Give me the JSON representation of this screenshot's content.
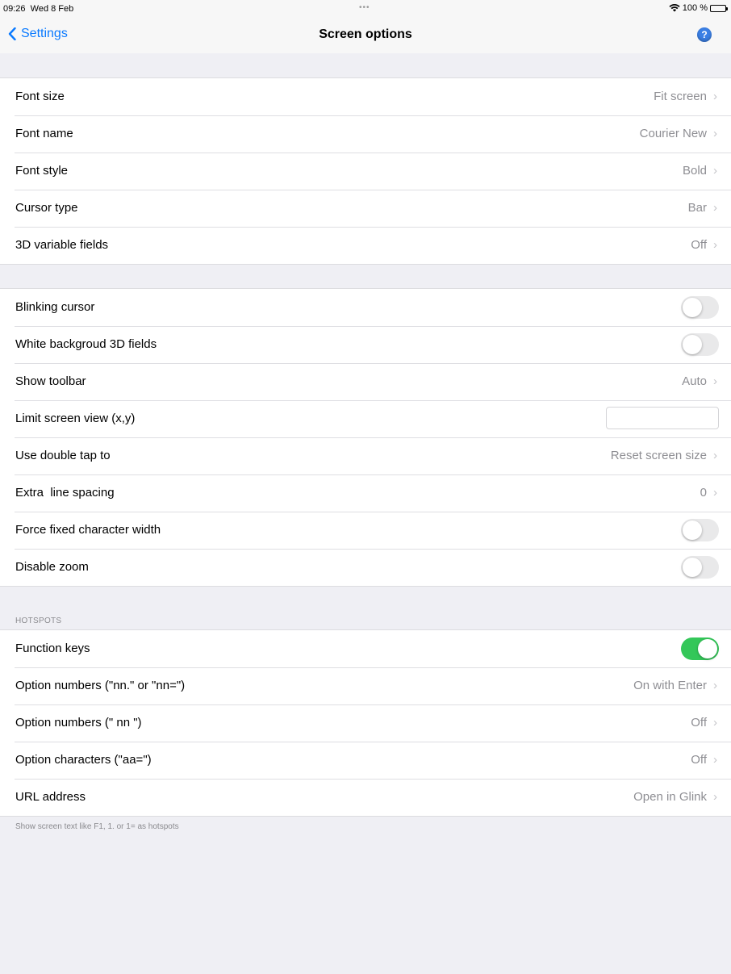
{
  "status": {
    "time": "09:26",
    "date": "Wed 8 Feb",
    "dots": "•••",
    "battery_text": "100 %",
    "wifi_icon": "wifi-icon",
    "battery_level": 1.0
  },
  "nav": {
    "back_label": "Settings",
    "title": "Screen options",
    "help_glyph": "?"
  },
  "group1": [
    {
      "label": "Font size",
      "value": "Fit screen"
    },
    {
      "label": "Font name",
      "value": "Courier New"
    },
    {
      "label": "Font style",
      "value": "Bold"
    },
    {
      "label": "Cursor type",
      "value": "Bar"
    },
    {
      "label": "3D variable fields",
      "value": "Off"
    }
  ],
  "group2": {
    "blinking_cursor": {
      "label": "Blinking cursor",
      "on": false
    },
    "white_bg_3d": {
      "label": "White backgroud 3D fields",
      "on": false
    },
    "show_toolbar": {
      "label": "Show toolbar",
      "value": "Auto"
    },
    "limit_view": {
      "label": "Limit screen view (x,y)",
      "value": ""
    },
    "double_tap": {
      "label": "Use double tap to",
      "value": "Reset screen size"
    },
    "line_spacing": {
      "label": "Extra  line spacing",
      "value": "0"
    },
    "fixed_width": {
      "label": "Force fixed character width",
      "on": false
    },
    "disable_zoom": {
      "label": "Disable zoom",
      "on": false
    }
  },
  "hotspots": {
    "header": "HOTSPOTS",
    "function_keys": {
      "label": "Function keys",
      "on": true
    },
    "option_numbers_dot": {
      "label": "Option numbers (\"nn.\" or \"nn=\")",
      "value": "On with Enter"
    },
    "option_numbers_space": {
      "label": "Option numbers (\" nn \")",
      "value": "Off"
    },
    "option_chars": {
      "label": "Option characters (\"aa=\")",
      "value": "Off"
    },
    "url_address": {
      "label": "URL address",
      "value": "Open in Glink"
    },
    "footer": "Show screen text like F1, 1. or 1= as hotspots"
  },
  "colors": {
    "accent": "#0a7aff",
    "toggle_on": "#34c759",
    "background": "#efeff4",
    "secondary_text": "#8e8e93"
  },
  "chevron": "›"
}
